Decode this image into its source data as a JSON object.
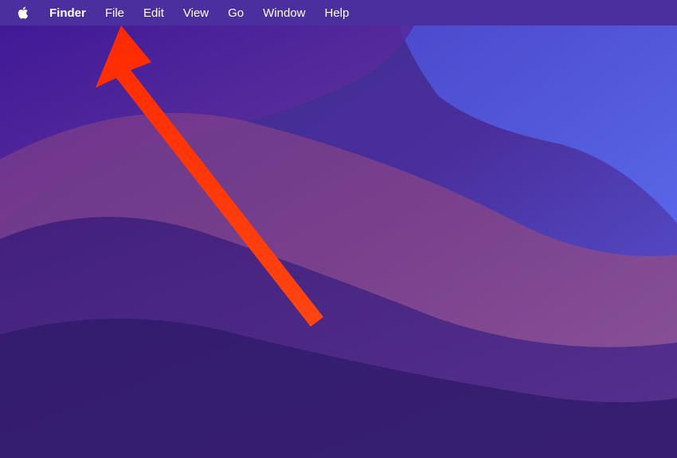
{
  "menubar": {
    "app_name": "Finder",
    "items": [
      {
        "label": "File"
      },
      {
        "label": "Edit"
      },
      {
        "label": "View"
      },
      {
        "label": "Go"
      },
      {
        "label": "Window"
      },
      {
        "label": "Help"
      }
    ]
  },
  "colors": {
    "menubar_bg": "#4b2f9e",
    "arrow": "#ff3a12"
  }
}
